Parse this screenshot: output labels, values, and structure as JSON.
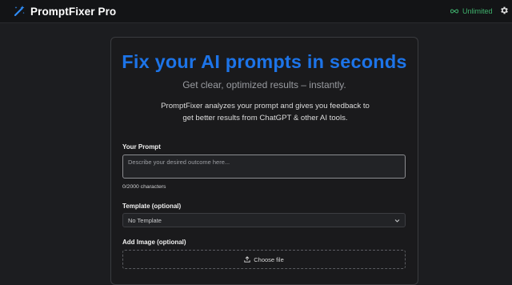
{
  "header": {
    "brand_name": "PromptFixer Pro",
    "brand_icon": "magic-wand-icon",
    "plan_label": "Unlimited",
    "plan_icon": "infinity-icon",
    "settings_icon": "gear-icon"
  },
  "hero": {
    "title": "Fix your AI prompts in seconds",
    "subtitle": "Get clear, optimized results – instantly.",
    "description": "PromptFixer analyzes your prompt and gives you feedback to get better results from ChatGPT & other AI tools."
  },
  "form": {
    "prompt_label": "Your Prompt",
    "prompt_placeholder": "Describe your desired outcome here...",
    "prompt_value": "",
    "char_counter": "0/2000 characters",
    "template_label": "Template (optional)",
    "template_selected": "No Template",
    "image_label": "Add Image (optional)",
    "image_button": "Choose file",
    "image_icon": "upload-icon"
  },
  "colors": {
    "accent": "#1d74e8",
    "plan_green": "#3fb26d",
    "background": "#1c1d20",
    "card": "#1a1a1c"
  }
}
